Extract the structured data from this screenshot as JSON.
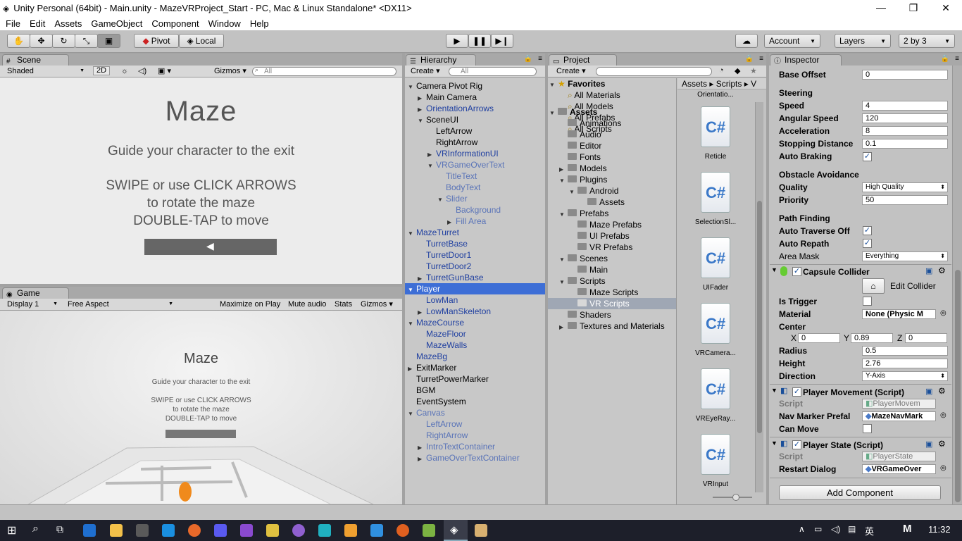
{
  "window": {
    "title": "Unity Personal (64bit) - Main.unity - MazeVRProject_Start - PC, Mac & Linux Standalone* <DX11>",
    "min": "—",
    "max": "❐",
    "close": "✕"
  },
  "menu": [
    "File",
    "Edit",
    "Assets",
    "GameObject",
    "Component",
    "Window",
    "Help"
  ],
  "toolbar": {
    "pivot": "Pivot",
    "local": "Local",
    "account": "Account",
    "layers": "Layers",
    "layout": "2 by 3"
  },
  "scene": {
    "tab": "Scene",
    "shading": "Shaded",
    "mode2d": "2D",
    "gizmos": "Gizmos",
    "search": "All",
    "title": "Maze",
    "subtitle": "Guide your character to the exit",
    "line1": "SWIPE or use CLICK ARROWS",
    "line2": "to rotate the maze",
    "line3": "DOUBLE-TAP to move"
  },
  "game": {
    "tab": "Game",
    "display": "Display 1",
    "aspect": "Free Aspect",
    "maximize": "Maximize on Play",
    "mute": "Mute audio",
    "stats": "Stats",
    "gizmos": "Gizmos",
    "title": "Maze",
    "subtitle": "Guide your character to the exit",
    "line1": "SWIPE or use CLICK ARROWS",
    "line2": "to rotate the maze",
    "line3": "DOUBLE-TAP to move"
  },
  "hierarchy": {
    "tab": "Hierarchy",
    "create": "Create",
    "search": "All",
    "items": [
      {
        "label": "Camera Pivot Rig",
        "indent": 0,
        "arrow": "▼",
        "blue": false
      },
      {
        "label": "Main Camera",
        "indent": 1,
        "arrow": "▶",
        "blue": false
      },
      {
        "label": "OrientationArrows",
        "indent": 1,
        "arrow": "▶",
        "blue": true
      },
      {
        "label": "SceneUI",
        "indent": 1,
        "arrow": "▼",
        "blue": false
      },
      {
        "label": "LeftArrow",
        "indent": 2,
        "arrow": "",
        "blue": false
      },
      {
        "label": "RightArrow",
        "indent": 2,
        "arrow": "",
        "blue": false
      },
      {
        "label": "VRInformationUI",
        "indent": 2,
        "arrow": "▶",
        "blue": true
      },
      {
        "label": "VRGameOverText",
        "indent": 2,
        "arrow": "▼",
        "blue": true,
        "faded": true
      },
      {
        "label": "TitleText",
        "indent": 3,
        "arrow": "",
        "blue": true,
        "faded": true
      },
      {
        "label": "BodyText",
        "indent": 3,
        "arrow": "",
        "blue": true,
        "faded": true
      },
      {
        "label": "Slider",
        "indent": 3,
        "arrow": "▼",
        "blue": true,
        "faded": true
      },
      {
        "label": "Background",
        "indent": 4,
        "arrow": "",
        "blue": true,
        "faded": true
      },
      {
        "label": "Fill Area",
        "indent": 4,
        "arrow": "▶",
        "blue": true,
        "faded": true
      },
      {
        "label": "MazeTurret",
        "indent": 0,
        "arrow": "▼",
        "blue": true
      },
      {
        "label": "TurretBase",
        "indent": 1,
        "arrow": "",
        "blue": true
      },
      {
        "label": "TurretDoor1",
        "indent": 1,
        "arrow": "",
        "blue": true
      },
      {
        "label": "TurretDoor2",
        "indent": 1,
        "arrow": "",
        "blue": true
      },
      {
        "label": "TurretGunBase",
        "indent": 1,
        "arrow": "▶",
        "blue": true
      },
      {
        "label": "Player",
        "indent": 0,
        "arrow": "▼",
        "blue": true,
        "selected": true
      },
      {
        "label": "LowMan",
        "indent": 1,
        "arrow": "",
        "blue": true
      },
      {
        "label": "LowManSkeleton",
        "indent": 1,
        "arrow": "▶",
        "blue": true
      },
      {
        "label": "MazeCourse",
        "indent": 0,
        "arrow": "▼",
        "blue": true
      },
      {
        "label": "MazeFloor",
        "indent": 1,
        "arrow": "",
        "blue": true
      },
      {
        "label": "MazeWalls",
        "indent": 1,
        "arrow": "",
        "blue": true
      },
      {
        "label": "MazeBg",
        "indent": 0,
        "arrow": "",
        "blue": true
      },
      {
        "label": "ExitMarker",
        "indent": 0,
        "arrow": "▶",
        "blue": false
      },
      {
        "label": "TurretPowerMarker",
        "indent": 0,
        "arrow": "",
        "blue": false
      },
      {
        "label": "BGM",
        "indent": 0,
        "arrow": "",
        "blue": false
      },
      {
        "label": "EventSystem",
        "indent": 0,
        "arrow": "",
        "blue": false
      },
      {
        "label": "Canvas",
        "indent": 0,
        "arrow": "▼",
        "blue": true,
        "faded": true
      },
      {
        "label": "LeftArrow",
        "indent": 1,
        "arrow": "",
        "blue": true,
        "faded": true
      },
      {
        "label": "RightArrow",
        "indent": 1,
        "arrow": "",
        "blue": true,
        "faded": true
      },
      {
        "label": "IntroTextContainer",
        "indent": 1,
        "arrow": "▶",
        "blue": true,
        "faded": true
      },
      {
        "label": "GameOverTextContainer",
        "indent": 1,
        "arrow": "▶",
        "blue": true,
        "faded": true
      }
    ]
  },
  "project": {
    "tab": "Project",
    "create": "Create",
    "breadcrumb": [
      "Assets",
      "Scripts",
      "V"
    ],
    "favorites": {
      "label": "Favorites",
      "items": [
        "All Materials",
        "All Models",
        "All Prefabs",
        "All Scripts"
      ]
    },
    "assets": [
      {
        "label": "Assets",
        "indent": 0,
        "arrow": "▼"
      },
      {
        "label": "Animations",
        "indent": 1,
        "arrow": ""
      },
      {
        "label": "Audio",
        "indent": 1,
        "arrow": ""
      },
      {
        "label": "Editor",
        "indent": 1,
        "arrow": ""
      },
      {
        "label": "Fonts",
        "indent": 1,
        "arrow": ""
      },
      {
        "label": "Models",
        "indent": 1,
        "arrow": "▶"
      },
      {
        "label": "Plugins",
        "indent": 1,
        "arrow": "▼"
      },
      {
        "label": "Android",
        "indent": 2,
        "arrow": "▼"
      },
      {
        "label": "Assets",
        "indent": 3,
        "arrow": ""
      },
      {
        "label": "Prefabs",
        "indent": 1,
        "arrow": "▼"
      },
      {
        "label": "Maze Prefabs",
        "indent": 2,
        "arrow": ""
      },
      {
        "label": "UI Prefabs",
        "indent": 2,
        "arrow": ""
      },
      {
        "label": "VR Prefabs",
        "indent": 2,
        "arrow": ""
      },
      {
        "label": "Scenes",
        "indent": 1,
        "arrow": "▼"
      },
      {
        "label": "Main",
        "indent": 2,
        "arrow": ""
      },
      {
        "label": "Scripts",
        "indent": 1,
        "arrow": "▼"
      },
      {
        "label": "Maze Scripts",
        "indent": 2,
        "arrow": ""
      },
      {
        "label": "VR Scripts",
        "indent": 2,
        "arrow": "",
        "selected": true
      },
      {
        "label": "Shaders",
        "indent": 1,
        "arrow": ""
      },
      {
        "label": "Textures and Materials",
        "indent": 1,
        "arrow": "▶"
      }
    ],
    "files": [
      "Orientatio...",
      "Reticle",
      "SelectionSl...",
      "UIFader",
      "VRCamera...",
      "VREyeRay...",
      "VRInput"
    ]
  },
  "inspector": {
    "tab": "Inspector",
    "base_offset": {
      "label": "Base Offset",
      "value": "0"
    },
    "steering": "Steering",
    "speed": {
      "label": "Speed",
      "value": "4"
    },
    "angular_speed": {
      "label": "Angular Speed",
      "value": "120"
    },
    "acceleration": {
      "label": "Acceleration",
      "value": "8"
    },
    "stopping_distance": {
      "label": "Stopping Distance",
      "value": "0.1"
    },
    "auto_braking": "Auto Braking",
    "obstacle": "Obstacle Avoidance",
    "quality": {
      "label": "Quality",
      "value": "High Quality"
    },
    "priority": {
      "label": "Priority",
      "value": "50"
    },
    "path_finding": "Path Finding",
    "auto_traverse": "Auto Traverse Off",
    "auto_repath": "Auto Repath",
    "area_mask": {
      "label": "Area Mask",
      "value": "Everything"
    },
    "capsule": {
      "title": "Capsule Collider",
      "edit": "Edit Collider",
      "is_trigger": "Is Trigger",
      "material": {
        "label": "Material",
        "value": "None (Physic M"
      },
      "center": {
        "label": "Center",
        "x": "0",
        "y": "0.89",
        "z": "0"
      },
      "radius": {
        "label": "Radius",
        "value": "0.5"
      },
      "height": {
        "label": "Height",
        "value": "2.76"
      },
      "direction": {
        "label": "Direction",
        "value": "Y-Axis"
      }
    },
    "player_movement": {
      "title": "Player Movement (Script)",
      "script": {
        "label": "Script",
        "value": "PlayerMovem"
      },
      "nav": {
        "label": "Nav Marker Prefal",
        "value": "MazeNavMark"
      },
      "can_move": "Can Move"
    },
    "player_state": {
      "title": "Player State (Script)",
      "script": {
        "label": "Script",
        "value": "PlayerState"
      },
      "restart": {
        "label": "Restart Dialog",
        "value": "VRGameOver"
      }
    },
    "add_component": "Add Component"
  },
  "taskbar": {
    "time": "11:32",
    "lang": "英",
    "ime": "M"
  }
}
